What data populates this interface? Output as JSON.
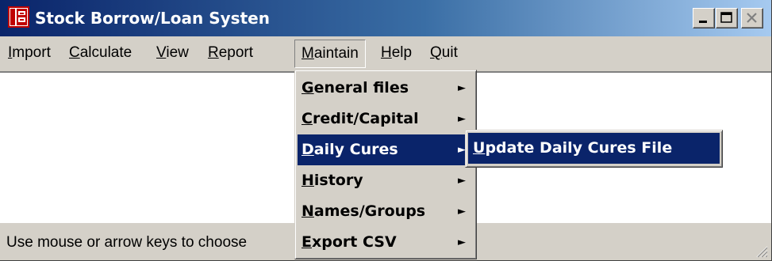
{
  "window": {
    "title": "Stock Borrow/Loan Systen",
    "colors": {
      "titlebar": "#0a246a",
      "highlight": "#0a246a",
      "face": "#d4d0c8"
    }
  },
  "menubar": {
    "items": [
      {
        "label": "Import"
      },
      {
        "label": "Calculate"
      },
      {
        "label": "View"
      },
      {
        "label": "Report"
      },
      {
        "label": "Maintain",
        "open": true
      },
      {
        "label": "Help"
      },
      {
        "label": "Quit"
      }
    ]
  },
  "maintain_menu": {
    "items": [
      {
        "label": "General files",
        "submenu_arrow": "►"
      },
      {
        "label": "Credit/Capital",
        "submenu_arrow": "►"
      },
      {
        "label": "Daily Cures",
        "submenu_arrow": "►",
        "selected": true
      },
      {
        "label": "History",
        "submenu_arrow": "►"
      },
      {
        "label": "Names/Groups",
        "submenu_arrow": "►"
      },
      {
        "label": "Export CSV",
        "submenu_arrow": "►"
      }
    ]
  },
  "daily_cures_submenu": {
    "items": [
      {
        "label": "Update Daily Cures File",
        "selected": true
      }
    ]
  },
  "statusbar": {
    "text": "Use mouse or arrow keys to choose"
  },
  "icons": {
    "app": "app-icon",
    "minimize": "minimize-icon",
    "maximize": "maximize-icon",
    "close": "close-icon",
    "submenu": "submenu-arrow-icon",
    "grip": "resize-grip-icon"
  }
}
